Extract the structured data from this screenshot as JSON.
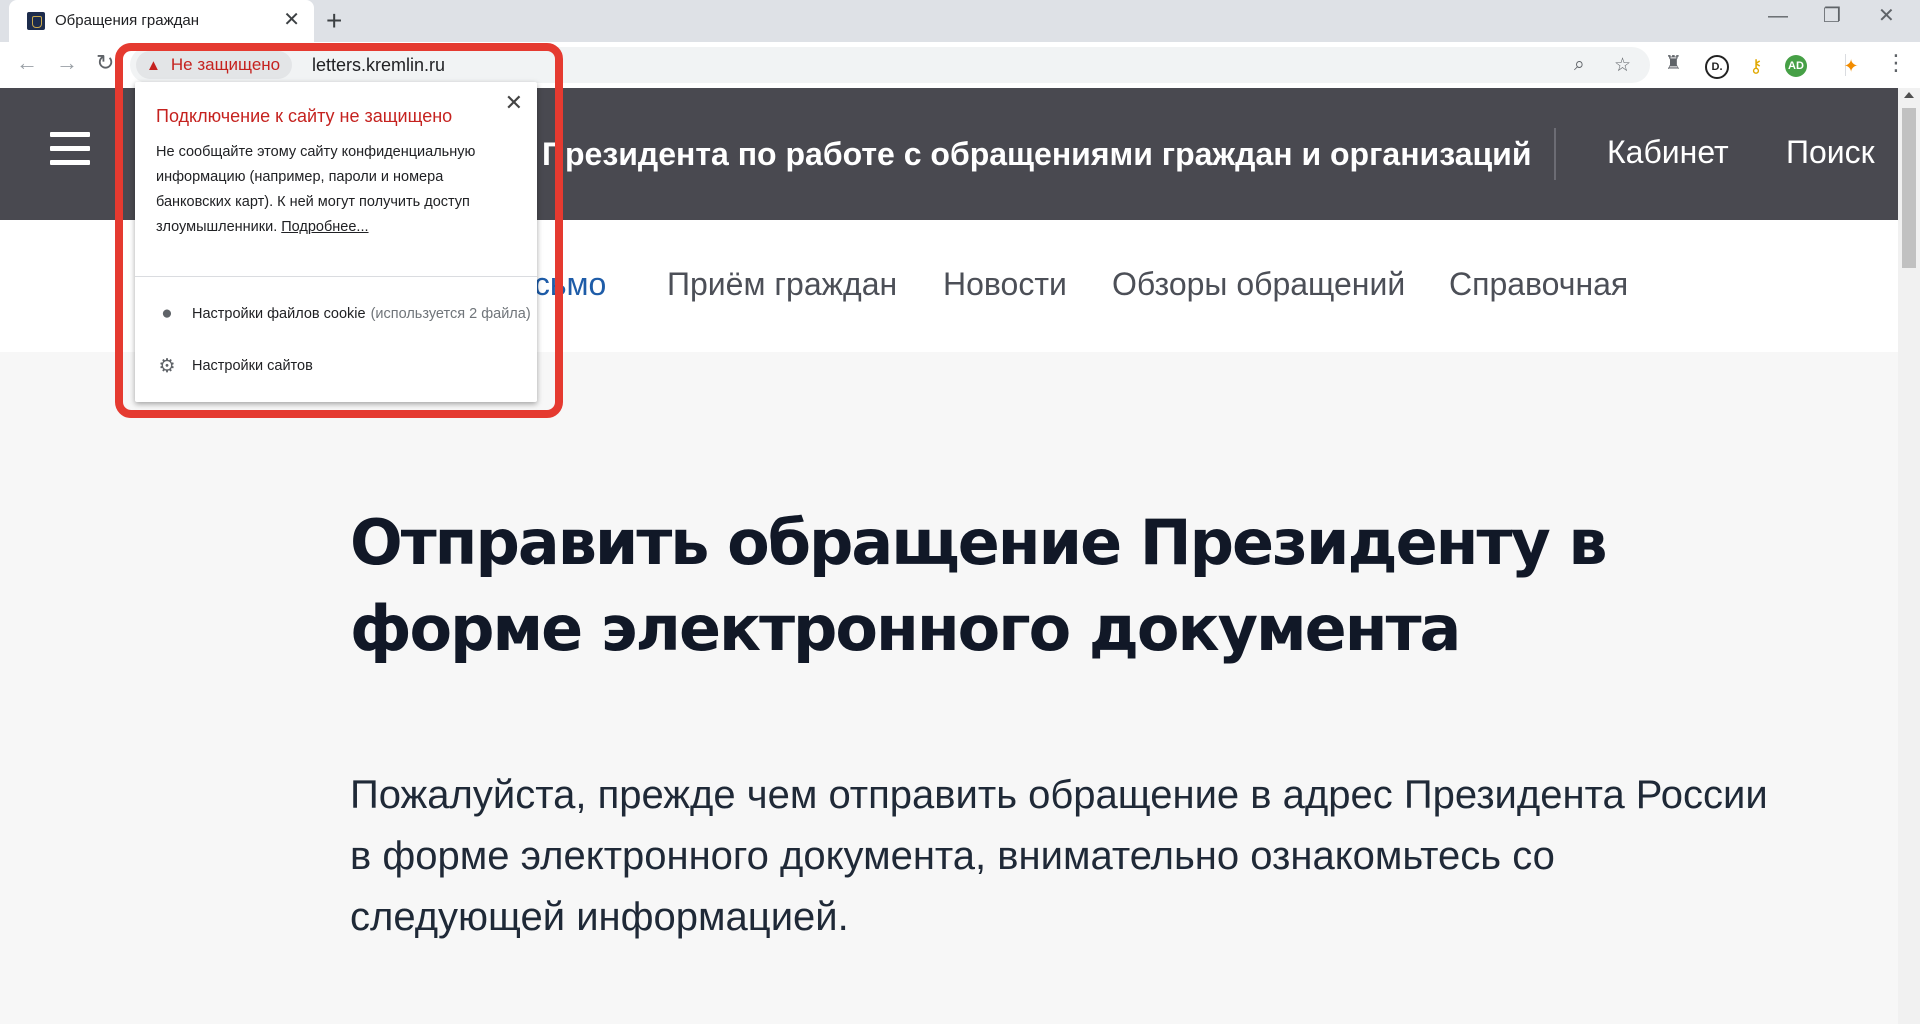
{
  "browser": {
    "tab": {
      "title": "Обращения граждан"
    },
    "address": {
      "security_label": "Не защищено",
      "url": "letters.kremlin.ru"
    },
    "extensions": [
      {
        "icon": "circle-d-icon",
        "label": "D.",
        "color": "#222222"
      },
      {
        "icon": "key-icon",
        "label": "",
        "color": "#e0a800"
      },
      {
        "icon": "adguard-icon",
        "label": "AD",
        "color": "#46a046"
      },
      {
        "icon": "avast-icon",
        "label": "",
        "color": "#f28c00"
      }
    ]
  },
  "site": {
    "header": {
      "title": "Президента по работе с обращениями граждан и организаций",
      "links": [
        "Кабинет",
        "Поиск"
      ]
    },
    "nav": {
      "items": [
        {
          "label": "исьмо",
          "active": true
        },
        {
          "label": "Приём граждан",
          "active": false
        },
        {
          "label": "Новости",
          "active": false
        },
        {
          "label": "Обзоры обращений",
          "active": false
        },
        {
          "label": "Справочная",
          "active": false
        }
      ]
    },
    "content": {
      "heading": "Отправить обращение Президенту в форме электронного документа",
      "intro": "Пожалуйста, прежде чем отправить обращение в адрес Президента России в форме электронного документа, внимательно ознакомьтесь со следующей информацией."
    }
  },
  "popup": {
    "title": "Подключение к сайту не защищено",
    "body": "Не сообщайте этому сайту конфиденциальную информацию (например, пароли и номера банковских карт). К ней могут получить доступ злоумышленники.",
    "link": "Подробнее...",
    "rows": [
      {
        "label": "Настройки файлов cookie",
        "detail": "(используется 2 файла)",
        "icon": "cookie-icon"
      },
      {
        "label": "Настройки сайтов",
        "icon": "gear-icon"
      }
    ]
  },
  "colors": {
    "header_bg": "#494950",
    "warning_red": "#c5221f",
    "highlight": "#e53a30",
    "nav_active": "#1e5ca8"
  }
}
